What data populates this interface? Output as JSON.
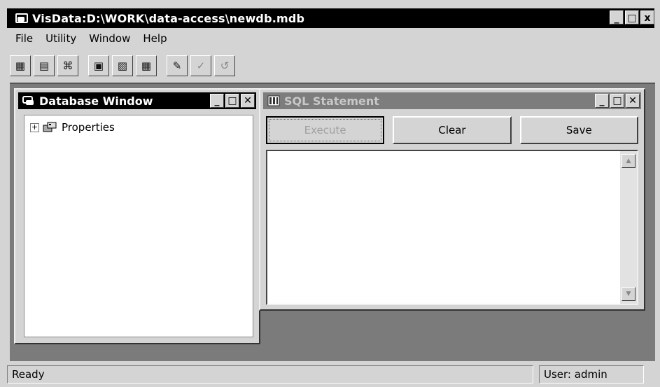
{
  "window": {
    "title": "VisData:D:\\WORK\\data-access\\newdb.mdb",
    "controls": {
      "minimize": "_",
      "maximize": "□",
      "close": "x"
    }
  },
  "menu": {
    "items": [
      {
        "label": "File"
      },
      {
        "label": "Utility"
      },
      {
        "label": "Window"
      },
      {
        "label": "Help"
      }
    ]
  },
  "toolbar": {
    "icons": [
      "table-type-icon",
      "dynaset-type-icon",
      "snapshot-type-icon",
      "form-data-control-icon",
      "form-no-data-control-icon",
      "form-grid-icon",
      "begin-transaction-icon",
      "commit-icon",
      "rollback-icon"
    ]
  },
  "database_window": {
    "title": "Database Window",
    "tree": [
      {
        "label": "Properties",
        "expand": "+"
      }
    ]
  },
  "sql_window": {
    "title": "SQL Statement",
    "buttons": {
      "execute": "Execute",
      "clear": "Clear",
      "save": "Save"
    },
    "text": ""
  },
  "status": {
    "left": "Ready",
    "right": "User: admin"
  },
  "colors": {
    "active_title": "#000000",
    "inactive_title": "#7d7d7d",
    "mdi_background": "#7b7b7b",
    "face": "#d4d4d4"
  }
}
